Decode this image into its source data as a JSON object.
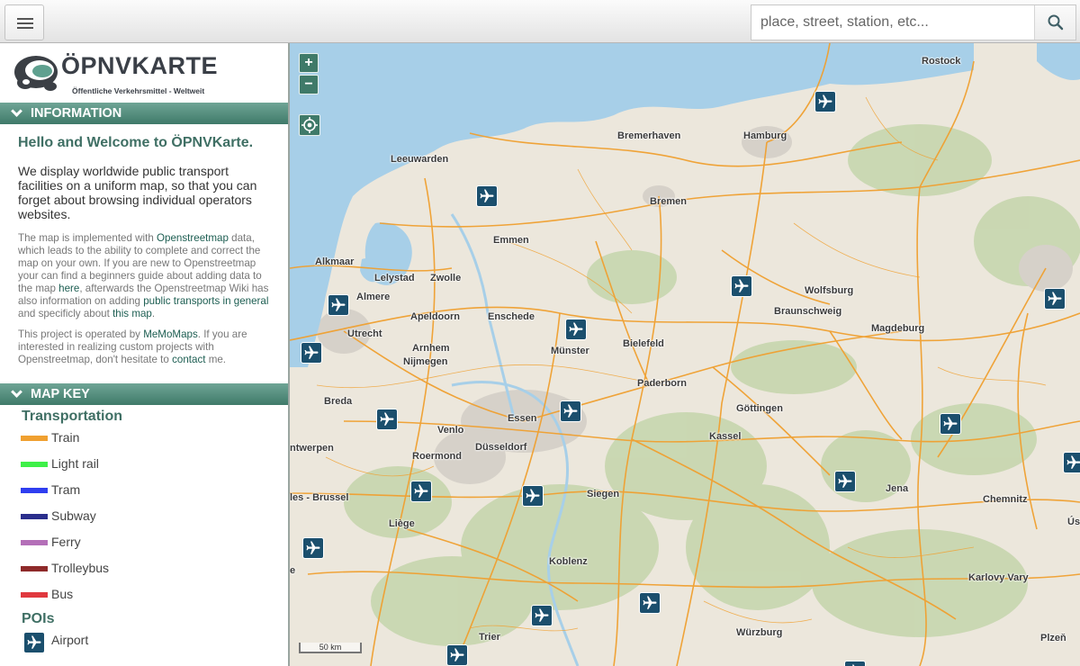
{
  "topbar": {
    "menu_icon": "hamburger-menu-icon",
    "search_placeholder": "place, street, station, etc...",
    "search_icon": "magnifier-search-icon"
  },
  "sidebar": {
    "logo_title": "ÖPNVKARTE",
    "logo_subtitle": "Öffentliche Verkehrsmittel - Weltweit",
    "information_header": "INFORMATION",
    "welcome": "Hello and Welcome to ÖPNVKarte.",
    "intro": "We display worldwide public transport facilities on a uniform map, so that you can forget about browsing individual operators websites.",
    "para1_a": "The map is implemented with ",
    "para1_link1": "Openstreetmap",
    "para1_b": " data, which leads to the ability to complete and correct the map on your own. If you are new to Openstreetmap your can find a beginners guide about adding data to the map ",
    "para1_link2": "here",
    "para1_c": ", afterwards the Openstreetmap Wiki has also information on adding ",
    "para1_link3": "public transports in general",
    "para1_d": " and specificly about ",
    "para1_link4": "this map",
    "para1_e": ".",
    "para2_a": "This project is operated by ",
    "para2_link1": "MeMoMaps",
    "para2_b": ". If you are interested in realizing custom projects with Openstreetmap, don't hesitate to ",
    "para2_link2": "contact",
    "para2_c": " me.",
    "mapkey_header": "MAP KEY",
    "transport_group": "Transportation",
    "transport_items": [
      {
        "label": "Train",
        "color": "#f0a030"
      },
      {
        "label": "Light rail",
        "color": "#3ef048"
      },
      {
        "label": "Tram",
        "color": "#2f3ef0"
      },
      {
        "label": "Subway",
        "color": "#2a2e8c"
      },
      {
        "label": "Ferry",
        "color": "#b46fb8"
      },
      {
        "label": "Trolleybus",
        "color": "#8e2a2a"
      },
      {
        "label": "Bus",
        "color": "#e0383e"
      }
    ],
    "poi_group": "POIs",
    "poi_items": [
      {
        "label": "Airport",
        "icon": "airplane-icon"
      }
    ]
  },
  "map": {
    "zoom_in": "+",
    "zoom_out": "−",
    "scale": "50 km",
    "cities": [
      "Rostock",
      "Bremerhaven",
      "Hamburg",
      "Leeuwarden",
      "Bremen",
      "Emmen",
      "Alkmaar",
      "Lelystad",
      "Zwolle",
      "Almere",
      "Wolfsburg",
      "Braunschweig",
      "Apeldoorn",
      "Enschede",
      "Utrecht",
      "Magdeburg",
      "Arnhem",
      "Münster",
      "Bielefeld",
      "Nijmegen",
      "Paderborn",
      "Breda",
      "Essen",
      "Göttingen",
      "Venlo",
      "Kassel",
      "ntwerpen",
      "Roermond",
      "Düsseldorf",
      "Jena",
      "les - Brussel",
      "Siegen",
      "Chemnitz",
      "Liège",
      "Úst",
      "e",
      "Koblenz",
      "Karlovy Vary",
      "Trier",
      "Würzburg",
      "Plzeň"
    ],
    "colors": {
      "water": "#a7cfe8",
      "land": "#ece7dc",
      "forest": "#c7d6ae",
      "rail": "#f0a030",
      "urban": "#d9d5cf",
      "airport": "#1b4f6d",
      "accent": "#3f7a69"
    }
  }
}
